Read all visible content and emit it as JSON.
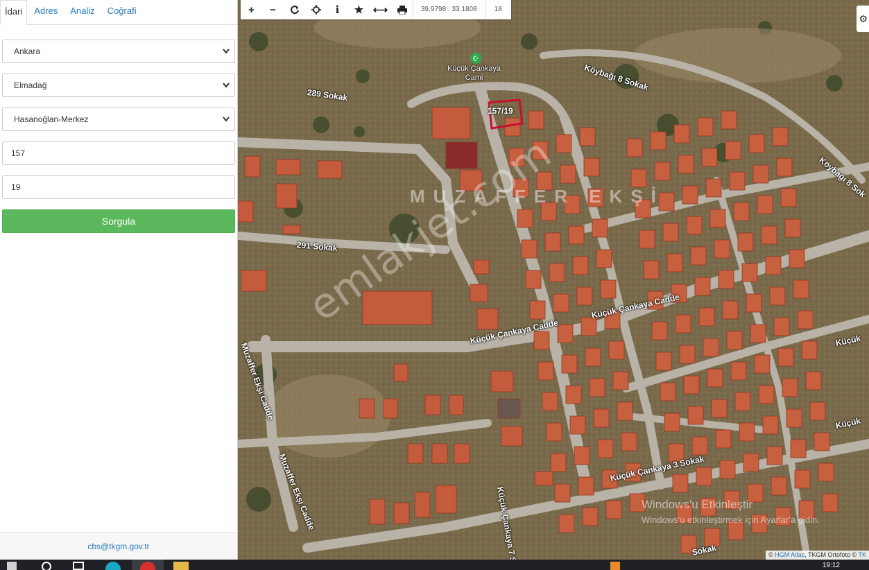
{
  "tabs": [
    "İdari",
    "Adres",
    "Analiz",
    "Coğrafi"
  ],
  "form": {
    "il": "Ankara",
    "ilce": "Elmadağ",
    "mahalle": "Hasanoğlan-Merkez",
    "ada": "157",
    "parsel": "19",
    "submit_label": "Sorgula"
  },
  "footer_email": "cbs@tkgm.gov.tr",
  "toolbar": {
    "icons": [
      "zoom-in-icon",
      "zoom-out-icon",
      "refresh-icon",
      "locate-icon",
      "info-icon",
      "favorite-icon",
      "measure-icon",
      "print-icon"
    ],
    "coordinates": "39.9798 : 33.1808",
    "zoom_level": "18"
  },
  "map": {
    "parcel_label": "157/19",
    "neighborhood_label": "MUZAFFER EKŞİ",
    "poi": {
      "line1": "Küçük Çankaya",
      "line2": "Cami"
    },
    "streets": {
      "s1": "289 Sokak",
      "s2": "Köybağı 8 Sokak",
      "s3": "Köybağı 8 Sok",
      "s4": "291 Sokak",
      "s5": "Küçük Çankaya Cadde",
      "s6": "Küçük Çankaya Cadde",
      "s7": "Muzaffer Ekşi Cadde",
      "s8": "Muzaffer Ekşi Cadde",
      "s9": "Küçük Çankaya 3 Sokak",
      "s10": "Küçük Çankaya 7 S",
      "s11": "Küçük",
      "s12": "Küçük",
      "s13": "Sokak"
    },
    "watermark": "emlakjet.com",
    "windows_activation": {
      "title": "Windows'u Etkinleştir",
      "subtitle": "Windows'u etkinleştirmek için Ayarlar'a gidin."
    },
    "attribution": {
      "prefix": "©",
      "hgm": "HGM Atlas",
      "rest": ", TKGM Ortofoto ©",
      "tk": "TK"
    }
  },
  "taskbar": {
    "time": "19:12"
  },
  "colors": {
    "accent": "#2a7ab8",
    "submit": "#5cb85c",
    "parcel_outline": "#c8102e",
    "roof": "#c0573a"
  }
}
